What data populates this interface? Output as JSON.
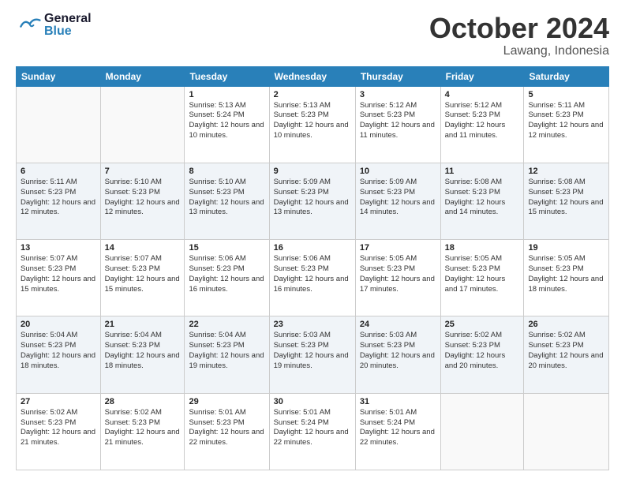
{
  "header": {
    "logo_general": "General",
    "logo_blue": "Blue",
    "month_title": "October 2024",
    "location": "Lawang, Indonesia"
  },
  "days_of_week": [
    "Sunday",
    "Monday",
    "Tuesday",
    "Wednesday",
    "Thursday",
    "Friday",
    "Saturday"
  ],
  "weeks": [
    [
      {
        "day": "",
        "sunrise": "",
        "sunset": "",
        "daylight": ""
      },
      {
        "day": "",
        "sunrise": "",
        "sunset": "",
        "daylight": ""
      },
      {
        "day": "1",
        "sunrise": "Sunrise: 5:13 AM",
        "sunset": "Sunset: 5:24 PM",
        "daylight": "Daylight: 12 hours and 10 minutes."
      },
      {
        "day": "2",
        "sunrise": "Sunrise: 5:13 AM",
        "sunset": "Sunset: 5:23 PM",
        "daylight": "Daylight: 12 hours and 10 minutes."
      },
      {
        "day": "3",
        "sunrise": "Sunrise: 5:12 AM",
        "sunset": "Sunset: 5:23 PM",
        "daylight": "Daylight: 12 hours and 11 minutes."
      },
      {
        "day": "4",
        "sunrise": "Sunrise: 5:12 AM",
        "sunset": "Sunset: 5:23 PM",
        "daylight": "Daylight: 12 hours and 11 minutes."
      },
      {
        "day": "5",
        "sunrise": "Sunrise: 5:11 AM",
        "sunset": "Sunset: 5:23 PM",
        "daylight": "Daylight: 12 hours and 12 minutes."
      }
    ],
    [
      {
        "day": "6",
        "sunrise": "Sunrise: 5:11 AM",
        "sunset": "Sunset: 5:23 PM",
        "daylight": "Daylight: 12 hours and 12 minutes."
      },
      {
        "day": "7",
        "sunrise": "Sunrise: 5:10 AM",
        "sunset": "Sunset: 5:23 PM",
        "daylight": "Daylight: 12 hours and 12 minutes."
      },
      {
        "day": "8",
        "sunrise": "Sunrise: 5:10 AM",
        "sunset": "Sunset: 5:23 PM",
        "daylight": "Daylight: 12 hours and 13 minutes."
      },
      {
        "day": "9",
        "sunrise": "Sunrise: 5:09 AM",
        "sunset": "Sunset: 5:23 PM",
        "daylight": "Daylight: 12 hours and 13 minutes."
      },
      {
        "day": "10",
        "sunrise": "Sunrise: 5:09 AM",
        "sunset": "Sunset: 5:23 PM",
        "daylight": "Daylight: 12 hours and 14 minutes."
      },
      {
        "day": "11",
        "sunrise": "Sunrise: 5:08 AM",
        "sunset": "Sunset: 5:23 PM",
        "daylight": "Daylight: 12 hours and 14 minutes."
      },
      {
        "day": "12",
        "sunrise": "Sunrise: 5:08 AM",
        "sunset": "Sunset: 5:23 PM",
        "daylight": "Daylight: 12 hours and 15 minutes."
      }
    ],
    [
      {
        "day": "13",
        "sunrise": "Sunrise: 5:07 AM",
        "sunset": "Sunset: 5:23 PM",
        "daylight": "Daylight: 12 hours and 15 minutes."
      },
      {
        "day": "14",
        "sunrise": "Sunrise: 5:07 AM",
        "sunset": "Sunset: 5:23 PM",
        "daylight": "Daylight: 12 hours and 15 minutes."
      },
      {
        "day": "15",
        "sunrise": "Sunrise: 5:06 AM",
        "sunset": "Sunset: 5:23 PM",
        "daylight": "Daylight: 12 hours and 16 minutes."
      },
      {
        "day": "16",
        "sunrise": "Sunrise: 5:06 AM",
        "sunset": "Sunset: 5:23 PM",
        "daylight": "Daylight: 12 hours and 16 minutes."
      },
      {
        "day": "17",
        "sunrise": "Sunrise: 5:05 AM",
        "sunset": "Sunset: 5:23 PM",
        "daylight": "Daylight: 12 hours and 17 minutes."
      },
      {
        "day": "18",
        "sunrise": "Sunrise: 5:05 AM",
        "sunset": "Sunset: 5:23 PM",
        "daylight": "Daylight: 12 hours and 17 minutes."
      },
      {
        "day": "19",
        "sunrise": "Sunrise: 5:05 AM",
        "sunset": "Sunset: 5:23 PM",
        "daylight": "Daylight: 12 hours and 18 minutes."
      }
    ],
    [
      {
        "day": "20",
        "sunrise": "Sunrise: 5:04 AM",
        "sunset": "Sunset: 5:23 PM",
        "daylight": "Daylight: 12 hours and 18 minutes."
      },
      {
        "day": "21",
        "sunrise": "Sunrise: 5:04 AM",
        "sunset": "Sunset: 5:23 PM",
        "daylight": "Daylight: 12 hours and 18 minutes."
      },
      {
        "day": "22",
        "sunrise": "Sunrise: 5:04 AM",
        "sunset": "Sunset: 5:23 PM",
        "daylight": "Daylight: 12 hours and 19 minutes."
      },
      {
        "day": "23",
        "sunrise": "Sunrise: 5:03 AM",
        "sunset": "Sunset: 5:23 PM",
        "daylight": "Daylight: 12 hours and 19 minutes."
      },
      {
        "day": "24",
        "sunrise": "Sunrise: 5:03 AM",
        "sunset": "Sunset: 5:23 PM",
        "daylight": "Daylight: 12 hours and 20 minutes."
      },
      {
        "day": "25",
        "sunrise": "Sunrise: 5:02 AM",
        "sunset": "Sunset: 5:23 PM",
        "daylight": "Daylight: 12 hours and 20 minutes."
      },
      {
        "day": "26",
        "sunrise": "Sunrise: 5:02 AM",
        "sunset": "Sunset: 5:23 PM",
        "daylight": "Daylight: 12 hours and 20 minutes."
      }
    ],
    [
      {
        "day": "27",
        "sunrise": "Sunrise: 5:02 AM",
        "sunset": "Sunset: 5:23 PM",
        "daylight": "Daylight: 12 hours and 21 minutes."
      },
      {
        "day": "28",
        "sunrise": "Sunrise: 5:02 AM",
        "sunset": "Sunset: 5:23 PM",
        "daylight": "Daylight: 12 hours and 21 minutes."
      },
      {
        "day": "29",
        "sunrise": "Sunrise: 5:01 AM",
        "sunset": "Sunset: 5:23 PM",
        "daylight": "Daylight: 12 hours and 22 minutes."
      },
      {
        "day": "30",
        "sunrise": "Sunrise: 5:01 AM",
        "sunset": "Sunset: 5:24 PM",
        "daylight": "Daylight: 12 hours and 22 minutes."
      },
      {
        "day": "31",
        "sunrise": "Sunrise: 5:01 AM",
        "sunset": "Sunset: 5:24 PM",
        "daylight": "Daylight: 12 hours and 22 minutes."
      },
      {
        "day": "",
        "sunrise": "",
        "sunset": "",
        "daylight": ""
      },
      {
        "day": "",
        "sunrise": "",
        "sunset": "",
        "daylight": ""
      }
    ]
  ]
}
